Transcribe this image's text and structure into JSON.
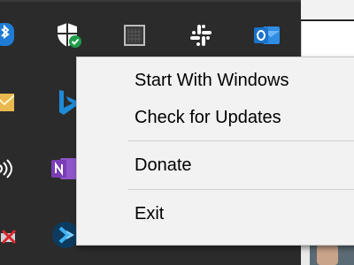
{
  "context_menu": {
    "items": [
      {
        "label": "Start With Windows"
      },
      {
        "label": "Check for Updates"
      },
      {
        "label": "Donate"
      },
      {
        "label": "Exit"
      }
    ]
  },
  "tray": {
    "icons": [
      "bluetooth-icon",
      "windows-security-icon",
      "window-grid-icon",
      "slack-icon",
      "outlook-icon",
      "mail-icon",
      "bing-icon",
      "network-audio-icon",
      "onenote-icon",
      "disconnected-drive-icon",
      "remote-desktop-icon"
    ]
  },
  "colors": {
    "tray_bg": "#2b2b2b",
    "menu_bg": "#f2f2f2",
    "bluetooth_blue": "#1e7bd6",
    "outlook_blue": "#1a73c9",
    "onenote_purple": "#7a3db6",
    "security_green": "#1f9c4a"
  }
}
